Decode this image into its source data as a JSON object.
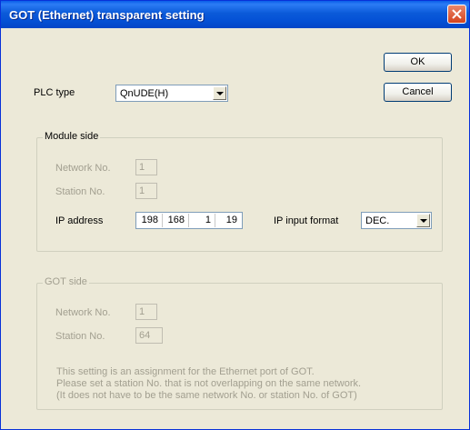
{
  "window": {
    "title": "GOT (Ethernet) transparent setting"
  },
  "buttons": {
    "ok": "OK",
    "cancel": "Cancel"
  },
  "plc": {
    "label": "PLC type",
    "value": "QnUDE(H)"
  },
  "module_side": {
    "title": "Module side",
    "network_label": "Network No.",
    "network_value": "1",
    "station_label": "Station No.",
    "station_value": "1",
    "ip_label": "IP address",
    "ip_octets": [
      "198",
      "168",
      "1",
      "19"
    ],
    "ip_format_label": "IP input format",
    "ip_format_value": "DEC."
  },
  "got_side": {
    "title": "GOT side",
    "network_label": "Network No.",
    "network_value": "1",
    "station_label": "Station No.",
    "station_value": "64",
    "note_lines": [
      "This setting is an assignment for the Ethernet port of GOT.",
      "Please set a station No. that is not overlapping on the same network.",
      "(It does not have to be the same network No. or station No. of GOT)"
    ]
  },
  "icons": {
    "close": "close-icon",
    "dropdown": "chevron-down-icon"
  },
  "colors": {
    "titlebar": "#0552d6",
    "close": "#d5431d",
    "dialog_bg": "#ece9d8",
    "disabled_text": "#a29f90"
  }
}
